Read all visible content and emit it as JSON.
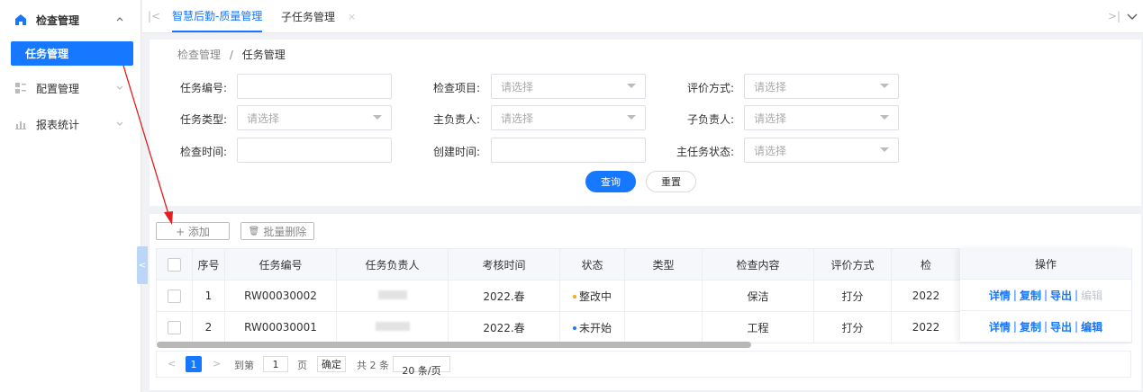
{
  "sidebar": {
    "groups": [
      {
        "label": "检查管理",
        "icon": "home-icon",
        "chevron": "^"
      },
      {
        "label": "配置管理",
        "icon": "grid-icon",
        "chevron": "v"
      },
      {
        "label": "报表统计",
        "icon": "bar-chart-icon",
        "chevron": "v"
      }
    ],
    "active_item": "任务管理"
  },
  "tabs": [
    {
      "label": "智慧后勤-质量管理",
      "active": true
    },
    {
      "label": "子任务管理",
      "closable": true
    }
  ],
  "tab_nav": {
    "first": "|<",
    "last": ">|",
    "menu": "v"
  },
  "breadcrumb": {
    "parent": "检查管理",
    "sep": "/",
    "current": "任务管理"
  },
  "filters": {
    "task_no": {
      "label": "任务编号:",
      "value": ""
    },
    "check_item": {
      "label": "检查项目:",
      "placeholder": "请选择"
    },
    "eval_method": {
      "label": "评价方式:",
      "placeholder": "请选择"
    },
    "task_type": {
      "label": "任务类型:",
      "placeholder": "请选择"
    },
    "main_owner": {
      "label": "主负责人:",
      "placeholder": "请选择"
    },
    "sub_owner": {
      "label": "子负责人:",
      "placeholder": "请选择"
    },
    "check_time": {
      "label": "检查时间:",
      "value": ""
    },
    "create_time": {
      "label": "创建时间:",
      "value": ""
    },
    "main_status": {
      "label": "主任务状态:",
      "placeholder": "请选择"
    }
  },
  "buttons": {
    "query": "查询",
    "reset": "重置",
    "add": "+ 添加",
    "batch_delete": "批量删除"
  },
  "table": {
    "headers": [
      "序号",
      "任务编号",
      "任务负责人",
      "考核时间",
      "状态",
      "类型",
      "检查内容",
      "评价方式",
      "检查",
      "操作"
    ],
    "headers_visible": [
      "序号",
      "任务编号",
      "任务负责人",
      "考核时间",
      "状态",
      "类型",
      "检查内容",
      "评价方式",
      "检",
      "操作"
    ],
    "rows": [
      {
        "no": "1",
        "task_no": "RW00030002",
        "owner": "",
        "period": "2022.春",
        "status": "整改中",
        "status_color": "#f5a623",
        "type": "",
        "content": "保洁",
        "eval": "打分",
        "check": "2022"
      },
      {
        "no": "2",
        "task_no": "RW00030001",
        "owner": "",
        "period": "2022.春",
        "status": "未开始",
        "status_color": "#1677ff",
        "type": "",
        "content": "工程",
        "eval": "打分",
        "check": "2022"
      }
    ],
    "actions": [
      "详情",
      "复制",
      "导出",
      "编辑"
    ],
    "action_sep": "|"
  },
  "pagination": {
    "current": "1",
    "goto_label": "到第",
    "goto_value": "1",
    "page_unit": "页",
    "confirm": "确定",
    "total": "共 2 条",
    "page_size": "20 条/页"
  },
  "colors": {
    "primary": "#1677ff",
    "annotation": "#e02020"
  }
}
